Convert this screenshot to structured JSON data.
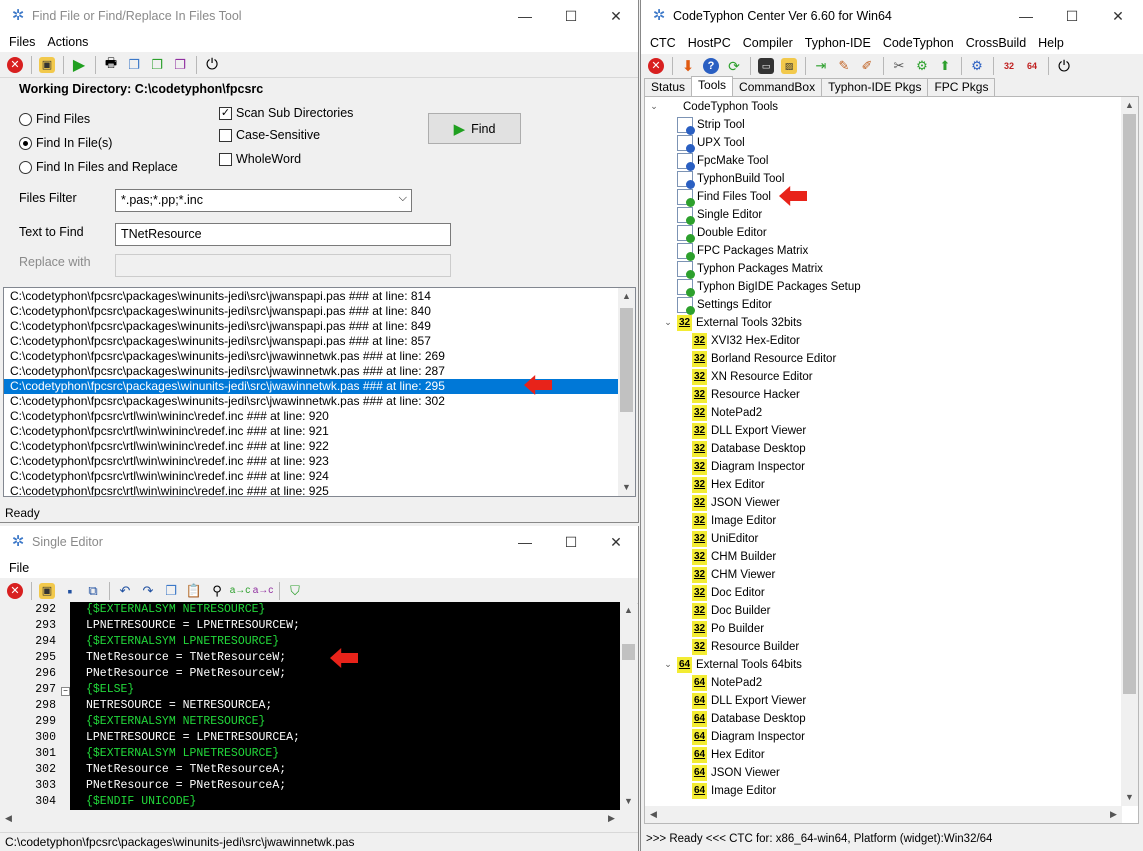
{
  "find_window": {
    "title": "Find File or Find/Replace In Files Tool",
    "menu": [
      "Files",
      "Actions"
    ],
    "working_directory_label": "Working Directory: C:\\codetyphon\\fpcsrc",
    "options": {
      "find_files": "Find Files",
      "find_in_files": "Find In File(s)",
      "find_and_replace": "Find In Files and Replace",
      "selected": "Find In File(s)"
    },
    "checkboxes": {
      "scan_sub": {
        "label": "Scan Sub Directories",
        "checked": true
      },
      "case_sensitive": {
        "label": "Case-Sensitive",
        "checked": false
      },
      "whole_word": {
        "label": "WholeWord",
        "checked": false
      }
    },
    "find_button": "Find",
    "files_filter_label": "Files Filter",
    "files_filter_value": "*.pas;*.pp;*.inc",
    "text_to_find_label": "Text to Find",
    "text_to_find_value": "TNetResource",
    "replace_with_label": "Replace with",
    "replace_with_value": "",
    "results": [
      "C:\\codetyphon\\fpcsrc\\packages\\winunits-jedi\\src\\jwanspapi.pas ### at line: 814",
      "C:\\codetyphon\\fpcsrc\\packages\\winunits-jedi\\src\\jwanspapi.pas ### at line: 840",
      "C:\\codetyphon\\fpcsrc\\packages\\winunits-jedi\\src\\jwanspapi.pas ### at line: 849",
      "C:\\codetyphon\\fpcsrc\\packages\\winunits-jedi\\src\\jwanspapi.pas ### at line: 857",
      "C:\\codetyphon\\fpcsrc\\packages\\winunits-jedi\\src\\jwawinnetwk.pas ### at line: 269",
      "C:\\codetyphon\\fpcsrc\\packages\\winunits-jedi\\src\\jwawinnetwk.pas ### at line: 287",
      "C:\\codetyphon\\fpcsrc\\packages\\winunits-jedi\\src\\jwawinnetwk.pas ### at line: 295",
      "C:\\codetyphon\\fpcsrc\\packages\\winunits-jedi\\src\\jwawinnetwk.pas ### at line: 302",
      "C:\\codetyphon\\fpcsrc\\rtl\\win\\wininc\\redef.inc ### at line: 920",
      "C:\\codetyphon\\fpcsrc\\rtl\\win\\wininc\\redef.inc ### at line: 921",
      "C:\\codetyphon\\fpcsrc\\rtl\\win\\wininc\\redef.inc ### at line: 922",
      "C:\\codetyphon\\fpcsrc\\rtl\\win\\wininc\\redef.inc ### at line: 923",
      "C:\\codetyphon\\fpcsrc\\rtl\\win\\wininc\\redef.inc ### at line: 924",
      "C:\\codetyphon\\fpcsrc\\rtl\\win\\wininc\\redef.inc ### at line: 925"
    ],
    "selected_result_index": 6,
    "status": "Ready"
  },
  "editor_window": {
    "title": "Single Editor",
    "menu": [
      "File"
    ],
    "lines": [
      {
        "n": "292",
        "text": "{$EXTERNALSYM NETRESOURCE}",
        "dir": true
      },
      {
        "n": "293",
        "text": "LPNETRESOURCE = LPNETRESOURCEW;",
        "dir": false
      },
      {
        "n": "294",
        "text": "{$EXTERNALSYM LPNETRESOURCE}",
        "dir": true
      },
      {
        "n": "295",
        "text": "TNetResource = TNetResourceW;",
        "dir": false
      },
      {
        "n": "296",
        "text": "PNetResource = PNetResourceW;",
        "dir": false
      },
      {
        "n": "297",
        "text": "{$ELSE}",
        "dir": true
      },
      {
        "n": "298",
        "text": "NETRESOURCE = NETRESOURCEA;",
        "dir": false
      },
      {
        "n": "299",
        "text": "{$EXTERNALSYM NETRESOURCE}",
        "dir": true
      },
      {
        "n": "300",
        "text": "LPNETRESOURCE = LPNETRESOURCEA;",
        "dir": false
      },
      {
        "n": "301",
        "text": "{$EXTERNALSYM LPNETRESOURCE}",
        "dir": true
      },
      {
        "n": "302",
        "text": "TNetResource = TNetResourceA;",
        "dir": false
      },
      {
        "n": "303",
        "text": "PNetResource = PNetResourceA;",
        "dir": false
      },
      {
        "n": "304",
        "text": "{$ENDIF UNICODE}",
        "dir": true
      }
    ],
    "status": "C:\\codetyphon\\fpcsrc\\packages\\winunits-jedi\\src\\jwawinnetwk.pas"
  },
  "ctc_window": {
    "title": "CodeTyphon Center Ver 6.60 for Win64",
    "menu": [
      "CTC",
      "HostPC",
      "Compiler",
      "Typhon-IDE",
      "CodeTyphon",
      "CrossBuild",
      "Help"
    ],
    "tabs": [
      "Status",
      "Tools",
      "CommandBox",
      "Typhon-IDE Pkgs",
      "FPC Pkgs"
    ],
    "active_tab": "Tools",
    "tree_root": "CodeTyphon Tools",
    "tools": [
      "Strip Tool",
      "UPX Tool",
      "FpcMake Tool",
      "TyphonBuild Tool",
      "Find Files Tool",
      "Single Editor",
      "Double Editor",
      "FPC Packages Matrix",
      "Typhon Packages Matrix",
      "Typhon BigIDE Packages Setup",
      "Settings Editor"
    ],
    "ext32_label": "External Tools 32bits",
    "ext32_badge": "32",
    "ext32": [
      "XVI32 Hex-Editor",
      "Borland Resource Editor",
      "XN Resource Editor",
      "Resource Hacker",
      "NotePad2",
      "DLL Export Viewer",
      "Database Desktop",
      "Diagram Inspector",
      "Hex Editor",
      "JSON Viewer",
      "Image Editor",
      "UniEditor",
      "CHM Builder",
      "CHM Viewer",
      "Doc Editor",
      "Doc Builder",
      "Po Builder",
      "Resource Builder"
    ],
    "ext64_label": "External Tools 64bits",
    "ext64_badge": "64",
    "ext64": [
      "NotePad2",
      "DLL Export Viewer",
      "Database Desktop",
      "Diagram Inspector",
      "Hex Editor",
      "JSON Viewer",
      "Image Editor"
    ],
    "status": ">>> Ready <<<  CTC for: x86_64-win64, Platform (widget):Win32/64"
  },
  "colors": {
    "selection": "#0078d7",
    "arrow": "#e8231a",
    "badge": "#f3ec33",
    "directive": "#22d83a"
  }
}
